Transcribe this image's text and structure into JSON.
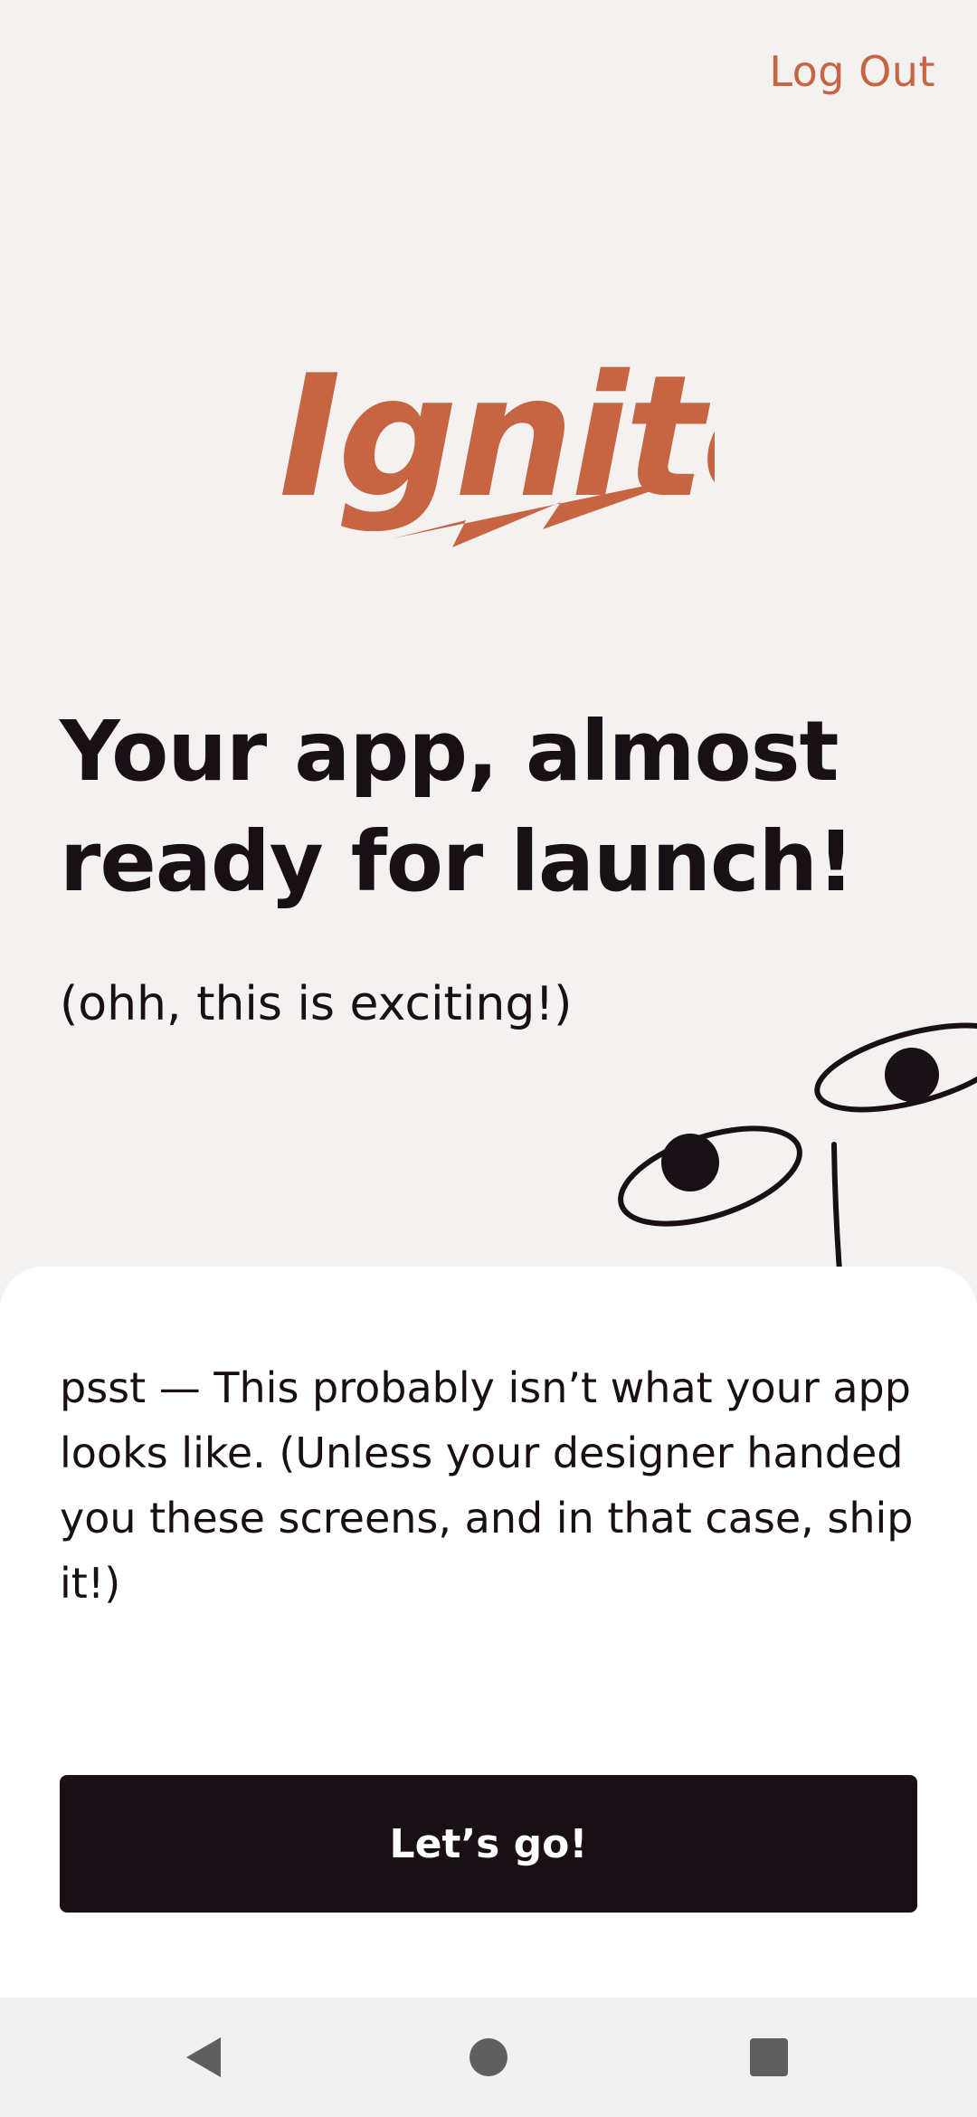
{
  "header": {
    "logout_label": "Log Out"
  },
  "logo": {
    "text": "Ignite",
    "color": "#C76542"
  },
  "welcome": {
    "heading": "Your app, almost ready for launch!",
    "subheading": "(ohh, this is exciting!)"
  },
  "card": {
    "body_text": "psst  — This probably isn’t what your app looks like. (Unless your designer handed you these screens, and in that case, ship it!)",
    "button_label": "Let’s go!"
  },
  "navigation_bar": {
    "back_icon": "triangle-back-icon",
    "home_icon": "circle-home-icon",
    "recents_icon": "square-recents-icon"
  },
  "colors": {
    "background": "#F4F2F1",
    "accent": "#C76542",
    "text": "#191015",
    "card": "#FFFFFF",
    "button": "#191015"
  }
}
